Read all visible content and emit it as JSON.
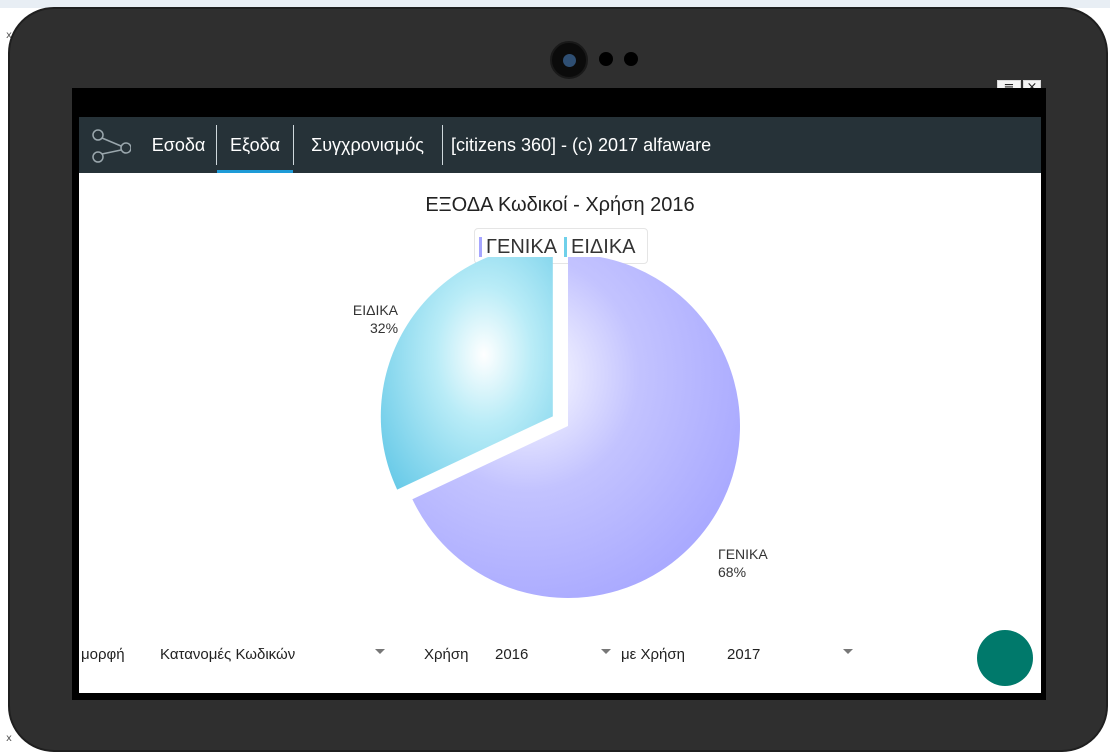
{
  "app": {
    "title": "[citizens 360] - (c) 2017 alfaware",
    "tabs": [
      {
        "label": "Εσοδα",
        "active": false
      },
      {
        "label": "Εξοδα",
        "active": true
      },
      {
        "label": "Συγχρονισμός",
        "active": false
      }
    ],
    "accent": "#1e9bd7",
    "appbar_color": "#263238"
  },
  "window_controls": {
    "menu": "≡",
    "close": "×"
  },
  "corner_marks": {
    "top_left": "x",
    "bottom_left": "x"
  },
  "chart": {
    "title": "ΕΞΟΔΑ Κωδικοί - Χρήση 2016",
    "legend": [
      {
        "name": "ΓΕΝΙΚΑ",
        "color": "#a6a6ff"
      },
      {
        "name": "ΕΙΔΙΚΑ",
        "color": "#6fd0ea"
      }
    ]
  },
  "chart_data": {
    "type": "pie",
    "title": "ΕΞΟΔΑ Κωδικοί - Χρήση 2016",
    "categories": [
      "ΓΕΝΙΚΑ",
      "ΕΙΔΙΚΑ"
    ],
    "values": [
      68,
      32
    ],
    "value_labels": [
      "68%",
      "32%"
    ],
    "colors": [
      "#a6a6ff",
      "#6fd0ea"
    ],
    "legend": "top-center",
    "exploded_slice": "ΕΙΔΙΚΑ"
  },
  "filters": {
    "morphi_label": "μορφή",
    "morphi_value": "Κατανομές Κωδικών",
    "xrisi_label": "Χρήση",
    "xrisi_value": "2016",
    "me_xrisi_label": "με Χρήση",
    "me_xrisi_value": "2017"
  },
  "fab": {
    "color": "#00796b",
    "icon": "action-button"
  }
}
